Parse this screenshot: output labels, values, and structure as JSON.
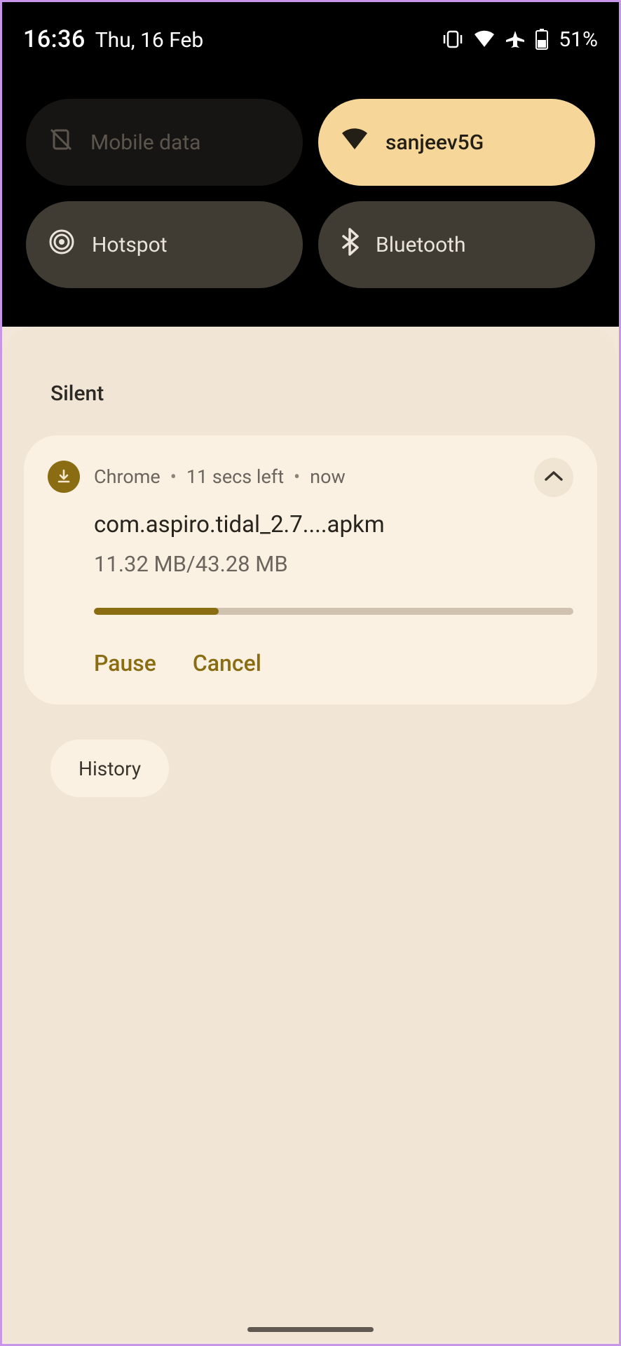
{
  "status": {
    "time": "16:36",
    "date": "Thu, 16 Feb",
    "battery": "51%"
  },
  "tiles": {
    "mobile_data": "Mobile data",
    "wifi": "sanjeev5G",
    "hotspot": "Hotspot",
    "bluetooth": "Bluetooth"
  },
  "section": {
    "silent": "Silent"
  },
  "notification": {
    "app": "Chrome",
    "time_left": "11 secs left",
    "when": "now",
    "title": "com.aspiro.tidal_2.7....apkm",
    "progress_text": "11.32 MB/43.28 MB",
    "progress_percent": 26,
    "actions": {
      "pause": "Pause",
      "cancel": "Cancel"
    }
  },
  "chips": {
    "history": "History"
  }
}
